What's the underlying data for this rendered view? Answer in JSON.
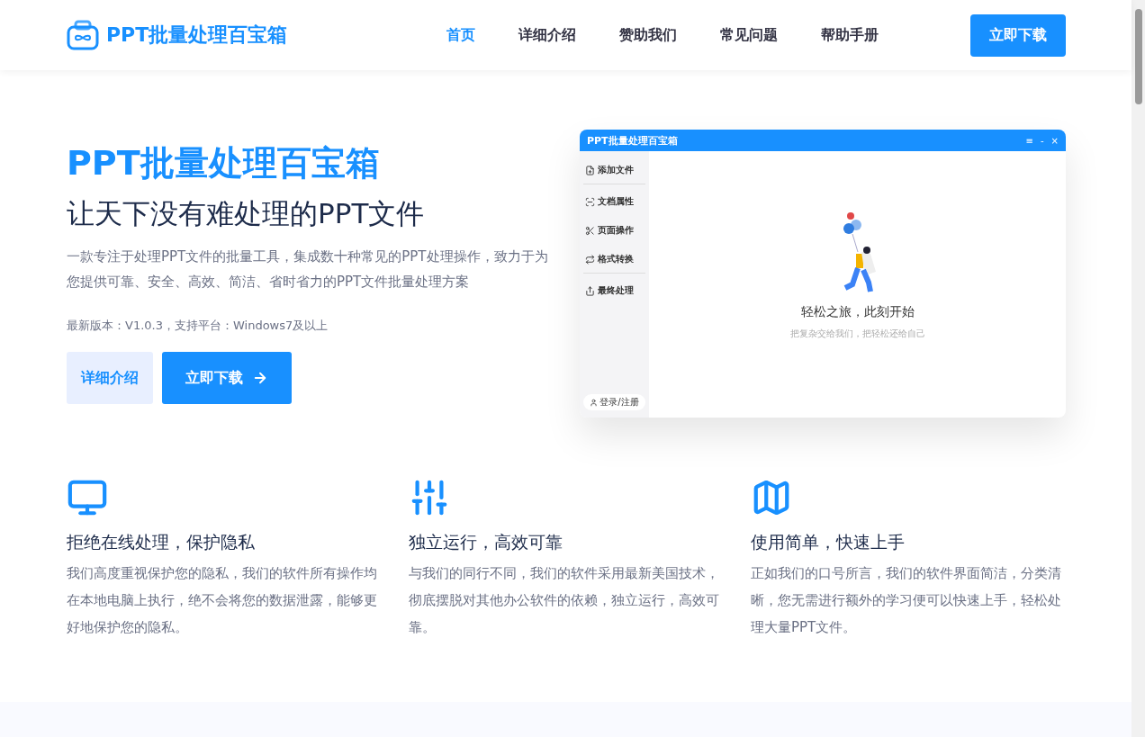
{
  "header": {
    "brand": "PPT批量处理百宝箱",
    "nav": [
      {
        "label": "首页",
        "selected": true
      },
      {
        "label": "详细介绍",
        "selected": false
      },
      {
        "label": "赞助我们",
        "selected": false
      },
      {
        "label": "常见问题",
        "selected": false
      },
      {
        "label": "帮助手册",
        "selected": false
      }
    ],
    "download_button": "立即下载"
  },
  "hero": {
    "title": "PPT批量处理百宝箱",
    "subtitle": "让天下没有难处理的PPT文件",
    "description": "一款专注于处理PPT文件的批量工具，集成数十种常见的PPT处理操作，致力于为您提供可靠、安全、高效、简洁、省时省力的PPT文件批量处理方案",
    "version_info": "最新版本：V1.0.3，支持平台：Windows7及以上",
    "buttons": [
      {
        "kind": "secondary",
        "label": "详细介绍"
      },
      {
        "kind": "primary",
        "label": "立即下载"
      }
    ]
  },
  "app_preview": {
    "title": "PPT批量处理百宝箱",
    "window_controls": [
      "≡",
      "-",
      "×"
    ],
    "sidebar": [
      {
        "kind": "add",
        "label": "添加文件"
      },
      {
        "kind": "props",
        "label": "文档属性"
      },
      {
        "kind": "tools",
        "label": "页面操作"
      },
      {
        "kind": "convert",
        "label": "格式转换"
      },
      {
        "kind": "export",
        "label": "最终处理"
      }
    ],
    "login_button": "登录/注册",
    "empty_title": "轻松之旅，此刻开始",
    "empty_subtitle": "把复杂交给我们，把轻松还给自己"
  },
  "features": [
    {
      "kind": "monitor",
      "title": "拒绝在线处理，保护隐私",
      "text": "我们高度重视保护您的隐私，我们的软件所有操作均在本地电脑上执行，绝不会将您的数据泄露，能够更好地保护您的隐私。"
    },
    {
      "kind": "sliders",
      "title": "独立运行，高效可靠",
      "text": "与我们的同行不同，我们的软件采用最新美国技术，彻底摆脱对其他办公软件的依赖，独立运行，高效可靠。"
    },
    {
      "kind": "map",
      "title": "使用简单，快速上手",
      "text": "正如我们的口号所言，我们的软件界面简洁，分类清晰，您无需进行额外的学习便可以快速上手，轻松处理大量PPT文件。"
    }
  ]
}
